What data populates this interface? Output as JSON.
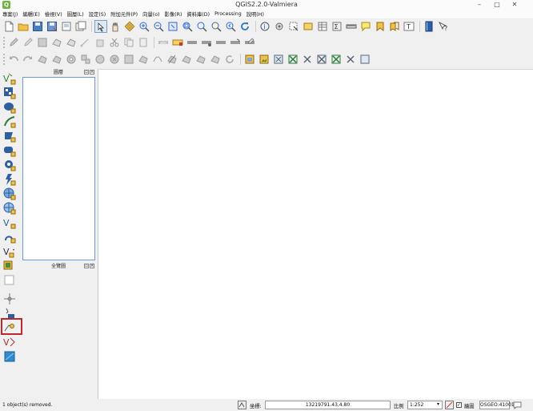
{
  "window": {
    "title": "QGIS2.2.0-Valmiera",
    "logo_letter": "Q",
    "controls": {
      "minimize": "–",
      "maximize": "□",
      "close": "✕"
    }
  },
  "menu": [
    "專案(J)",
    "編輯(E)",
    "檢視(V)",
    "圖層(L)",
    "設定(S)",
    "附加元件(P)",
    "向量(o)",
    "影像(R)",
    "資料庫(D)",
    "Processing",
    "說明(H)"
  ],
  "panels": {
    "layers": {
      "title": "圖層"
    },
    "overview": {
      "title": "全覽圖"
    }
  },
  "status": {
    "message": "1 object(s) removed.",
    "coord_label": "坐標:",
    "coord_value": "13219791.43,4.80",
    "scale_label": "比例",
    "scale_value": "1:252",
    "render_label": "繪圖",
    "render_checked": true,
    "crs": "OSGEO:41001"
  },
  "colors": {
    "highlight_box": "#c0282d",
    "layers_panel_border": "#6a9ad7",
    "logo": "#6fb23e"
  }
}
